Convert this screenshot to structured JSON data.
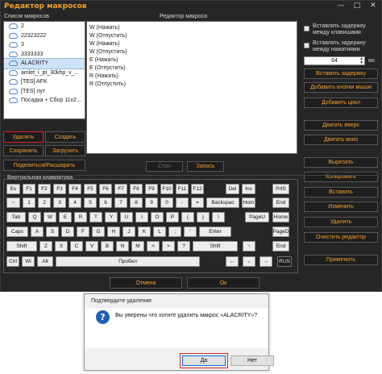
{
  "window": {
    "title": "Редактор макросов",
    "controls": [
      "—",
      "□",
      "✕"
    ]
  },
  "macro_list": {
    "header": "Список макросов",
    "items": [
      "2",
      "22323222",
      "3",
      "3333333",
      "ALACRITY",
      "amlet_i_pt_30khp_v_...",
      "[TES] AFK",
      "[TES] лут",
      "Посадка + Сбор 11х2..."
    ],
    "selected_index": 4,
    "delete_label": "Удалить",
    "create_label": "Создать",
    "save_label": "Сохранить",
    "load_label": "Загрузить",
    "share_label": "Поделиться/Расшарить"
  },
  "editor": {
    "header": "Редактор макроса",
    "lines": [
      "W (Нажать)",
      "W (Отпустить)",
      "W (Нажать)",
      "W (Отпустить)",
      "E (Нажать)",
      "E (Отпустить)",
      "R (Нажать)",
      "R (Отпустить)"
    ],
    "stop_label": "Стоп",
    "record_label": "Запись"
  },
  "right_panel": {
    "delay_keys_label": "Вставлять задержку между клавишами",
    "delay_press_label": "Вставлять задержку между нажатиями",
    "delay_value": "64",
    "delay_unit": "мс",
    "buttons": [
      "Вставить задержку",
      "Добавить кнопки мыши",
      "Добавить цикл",
      "Двигать вверх",
      "Двигать вниз",
      "Вырезать",
      "Копировать",
      "Вставить",
      "Изменить",
      "Удалить",
      "Очистить редактор",
      "Применить"
    ]
  },
  "keyboard": {
    "header": "Виртуальная клавиатура",
    "rows": [
      [
        "Es",
        "F1",
        "F2",
        "F3",
        "F4",
        "F5",
        "F6",
        "F7",
        "F8",
        "F9",
        "F10",
        "F11",
        "F12",
        "Del",
        "Ins",
        "PrtS"
      ],
      [
        "~",
        "1",
        "2",
        "3",
        "4",
        "5",
        "6",
        "7",
        "8",
        "9",
        "0",
        "-",
        "=",
        "Backspac",
        "Hom",
        "End"
      ],
      [
        "Tab",
        "Q",
        "W",
        "E",
        "R",
        "T",
        "Y",
        "U",
        "I",
        "O",
        "P",
        "{",
        "}",
        "\\",
        "PageU",
        "Home"
      ],
      [
        "Caps",
        "A",
        "S",
        "D",
        "F",
        "G",
        "H",
        "J",
        "K",
        "L",
        ";",
        "'",
        "Enter",
        "PageD"
      ],
      [
        "Shift",
        "Z",
        "X",
        "C",
        "V",
        "B",
        "N",
        "M",
        "<",
        ">",
        "?",
        "Shift",
        "↑",
        "End"
      ],
      [
        "Ctrl",
        "Wi",
        "Alt",
        "Пробел",
        "←",
        "↓",
        "→",
        "RUS"
      ]
    ]
  },
  "footer": {
    "cancel_label": "Отмена",
    "ok_label": "Ок"
  },
  "dialog": {
    "title": "Подтвердите удаление",
    "icon": "question-icon",
    "message": "Вы уверены что хотите удалить макрос «ALACRITY»?",
    "yes_label": "Да",
    "no_label": "Нет"
  },
  "colors": {
    "accent": "#f0a030",
    "window_bg": "#262626",
    "highlight": "#dd2222"
  }
}
